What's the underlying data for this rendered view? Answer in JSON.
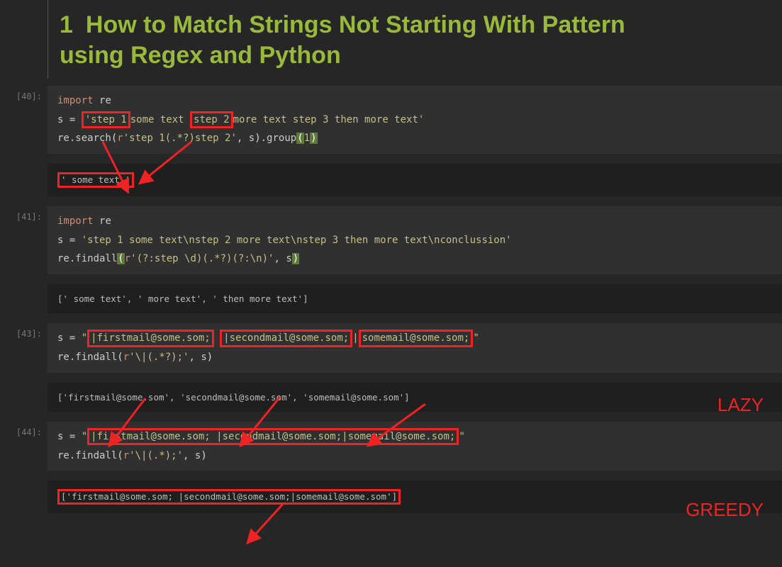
{
  "heading": {
    "number": "1",
    "title": "How to Match Strings Not Starting With Pattern using Regex and Python"
  },
  "labels": {
    "lazy": "LAZY",
    "greedy": "GREEDY"
  },
  "cell40": {
    "prompt": "[40]:",
    "tok": {
      "import": "import",
      "re": "re",
      "s_eq": "s = ",
      "q1": "'",
      "step1": "step 1 ",
      "sometxt": "some text ",
      "step2": "step 2 ",
      "rest": "more text step 3 then more text'",
      "call_a": "re.search",
      "paren_open": "(",
      "rlit": "r",
      "regex": "'step 1(.*?)step 2'",
      "comma_s": ", s",
      "paren_close": ")",
      "group": ".group",
      "gparen_o": "(",
      "one": "1",
      "gparen_c": ")"
    },
    "output": "' some text '"
  },
  "cell41": {
    "prompt": "[41]:",
    "tok": {
      "import": "import",
      "re": "re",
      "s_eq": "s = ",
      "str": "'step 1 some text\\nstep 2 more text\\nstep 3 then more text\\nconclussion'",
      "call": "re.findall",
      "po": "(",
      "rlit": "r",
      "regex": "'(?:step \\d)(.*?)(?:\\n)'",
      "cs": ", s",
      "pc": ")"
    },
    "output": "[' some text', ' more text', ' then more text']"
  },
  "cell43": {
    "prompt": "[43]:",
    "tok": {
      "s_eq": "s = ",
      "qo": "\"",
      "m1": "|firstmail@some.som; ",
      "sp1": " ",
      "m2": "|secondmail@some.som;",
      "sp2b": "|",
      "m3": "somemail@some.som;",
      "qend": "\"",
      "call": "re.findall",
      "po": "(",
      "rlit": "r",
      "regex": "'\\|(.*?);'",
      "cs": ", s",
      "pc": ")"
    },
    "output": "['firstmail@some.som', 'secondmail@some.som', 'somemail@some.som']"
  },
  "cell44": {
    "prompt": "[44]:",
    "tok": {
      "s_eq": "s = ",
      "qo": "\"",
      "body": "|firstmail@some.som;  |secondmail@some.som;|somemail@some.som;",
      "qc": "\"",
      "call": "re.findall",
      "po": "(",
      "rlit": "r",
      "regex": "'\\|(.*);'",
      "cs": ", s",
      "pc": ")"
    },
    "output": "['firstmail@some.som;  |secondmail@some.som;|somemail@some.som']"
  }
}
